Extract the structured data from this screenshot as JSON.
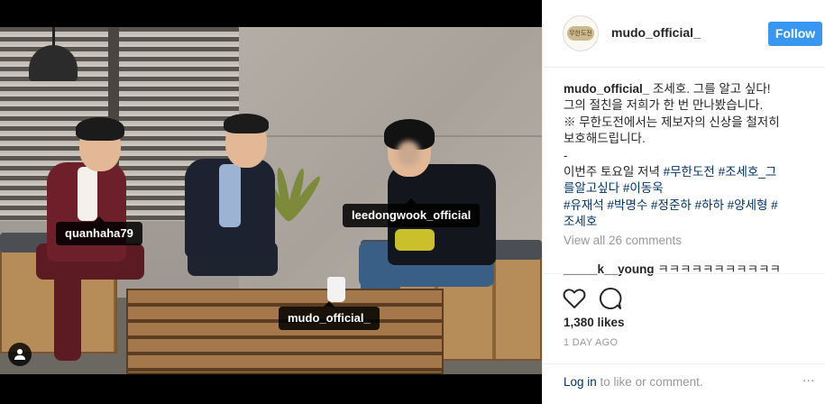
{
  "post": {
    "username": "mudo_official_",
    "follow_label": "Follow",
    "avatar_text": "무한도전",
    "tags": {
      "left": "quanhaha79",
      "right": "leedongwook_official",
      "bottom": "mudo_official_"
    },
    "caption": {
      "username": "mudo_official_",
      "line1": " 조세호. 그를 알고 싶다!",
      "line2": "그의 절친을 저희가 한 번 만나봤습니다.",
      "line3": "※ 무한도전에서는 제보자의 신상을 철저히",
      "line4": "보호해드립니다.",
      "line5": "-",
      "line6_text": "이번주 토요일 저녁 ",
      "hashtag_line6": "#무한도전 #조세호_그",
      "hashtag_line7": "를알고싶다 #이동욱",
      "hashtag_line8": "#유재석 #박명수 #정준하 #하하 #양세형 #",
      "hashtag_line9": "조세호"
    },
    "view_all_comments": "View all 26 comments",
    "comment": {
      "username": "_____k__young",
      "text": " ㅋㅋㅋㅋㅋㅋㅋㅋㅋㅋㅋ"
    },
    "likes": "1,380 likes",
    "date": "1 DAY AGO",
    "login": {
      "link": "Log in",
      "rest": " to like or comment.",
      "more_label": "..."
    }
  }
}
